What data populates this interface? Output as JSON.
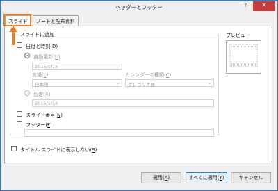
{
  "window": {
    "title": "ヘッダーとフッター",
    "help": "?",
    "close": "✕"
  },
  "tabs": [
    {
      "label": "スライド"
    },
    {
      "label": "ノートと配布資料"
    }
  ],
  "group": {
    "label": "スライドに追加"
  },
  "date_time": {
    "label": "日付と時刻",
    "accel": "D"
  },
  "auto_update": {
    "label": "自動更新",
    "accel": "U",
    "value": "2015/1/16"
  },
  "language": {
    "label": "言語",
    "accel": "L",
    "value": "日本語"
  },
  "calendar": {
    "label": "カレンダーの種類",
    "accel": "C",
    "value": "グレゴリオ暦"
  },
  "fixed": {
    "label": "固定",
    "accel": "X",
    "value": "2015/1/16"
  },
  "slide_number": {
    "label": "スライド番号",
    "accel": "N"
  },
  "footer": {
    "label": "フッター",
    "accel": "F",
    "value": ""
  },
  "title_slide": {
    "label": "タイトル スライドに表示しない",
    "accel": "S"
  },
  "preview": {
    "label": "プレビュー"
  },
  "buttons": {
    "apply": {
      "label": "適用",
      "accel": "A"
    },
    "apply_all": {
      "label": "すべてに適用",
      "accel": "Y"
    },
    "cancel": {
      "label": "キャンセル"
    }
  },
  "colors": {
    "highlight": "#f07a1e",
    "close": "#c83c3c",
    "border": "#3c78c8"
  }
}
